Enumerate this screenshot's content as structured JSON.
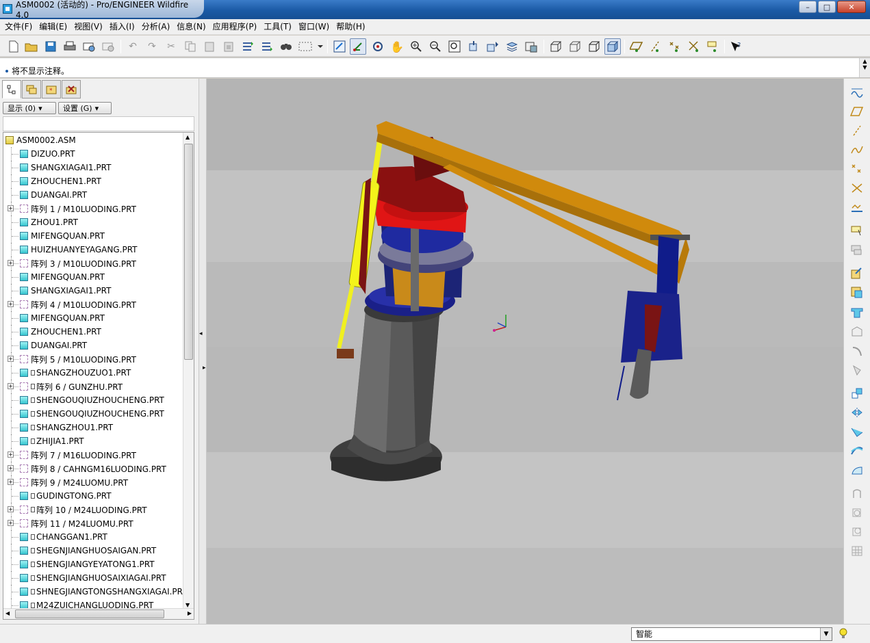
{
  "window": {
    "title": "ASM0002 (活动的) - Pro/ENGINEER Wildfire 4.0",
    "min_glyph": "–",
    "max_glyph": "□",
    "close_glyph": "✕"
  },
  "menu": [
    "文件(F)",
    "编辑(E)",
    "视图(V)",
    "插入(I)",
    "分析(A)",
    "信息(N)",
    "应用程序(P)",
    "工具(T)",
    "窗口(W)",
    "帮助(H)"
  ],
  "message": {
    "text": "将不显示注释。"
  },
  "model_tree": {
    "show_button": "显示 (0)",
    "settings_button": "设置 (G)",
    "items": [
      {
        "label": "ASM0002.ASM",
        "type": "asm",
        "level": 0,
        "expander": false
      },
      {
        "label": "DIZUO.PRT",
        "type": "prt",
        "level": 1,
        "expander": false
      },
      {
        "label": "SHANGXIAGAI1.PRT",
        "type": "prt",
        "level": 1,
        "expander": false
      },
      {
        "label": "ZHOUCHEN1.PRT",
        "type": "prt",
        "level": 1,
        "expander": false
      },
      {
        "label": "DUANGAI.PRT",
        "type": "prt",
        "level": 1,
        "expander": false
      },
      {
        "label": "阵列 1 / M10LUODING.PRT",
        "type": "pat",
        "level": 1,
        "expander": true
      },
      {
        "label": "ZHOU1.PRT",
        "type": "prt",
        "level": 1,
        "expander": false
      },
      {
        "label": "MIFENGQUAN.PRT",
        "type": "prt",
        "level": 1,
        "expander": false
      },
      {
        "label": "HUIZHUANYEYAGANG.PRT",
        "type": "prt",
        "level": 1,
        "expander": false
      },
      {
        "label": "阵列 3 / M10LUODING.PRT",
        "type": "pat",
        "level": 1,
        "expander": true
      },
      {
        "label": "MIFENGQUAN.PRT",
        "type": "prt",
        "level": 1,
        "expander": false
      },
      {
        "label": "SHANGXIAGAI1.PRT",
        "type": "prt",
        "level": 1,
        "expander": false
      },
      {
        "label": "阵列 4 / M10LUODING.PRT",
        "type": "pat",
        "level": 1,
        "expander": true
      },
      {
        "label": "MIFENGQUAN.PRT",
        "type": "prt",
        "level": 1,
        "expander": false
      },
      {
        "label": "ZHOUCHEN1.PRT",
        "type": "prt",
        "level": 1,
        "expander": false
      },
      {
        "label": "DUANGAI.PRT",
        "type": "prt",
        "level": 1,
        "expander": false
      },
      {
        "label": "阵列 5 / M10LUODING.PRT",
        "type": "pat",
        "level": 1,
        "expander": true
      },
      {
        "label": "SHANGZHOUZUO1.PRT",
        "type": "prt-small",
        "level": 1,
        "expander": false
      },
      {
        "label": "阵列 6 / GUNZHU.PRT",
        "type": "pat-small",
        "level": 1,
        "expander": true
      },
      {
        "label": "SHENGOUQIUZHOUCHENG.PRT",
        "type": "prt-small",
        "level": 1,
        "expander": false
      },
      {
        "label": "SHENGOUQIUZHOUCHENG.PRT",
        "type": "prt-small",
        "level": 1,
        "expander": false
      },
      {
        "label": "SHANGZHOU1.PRT",
        "type": "prt-small",
        "level": 1,
        "expander": false
      },
      {
        "label": "ZHIJIA1.PRT",
        "type": "prt-small",
        "level": 1,
        "expander": false
      },
      {
        "label": "阵列 7 / M16LUODING.PRT",
        "type": "pat",
        "level": 1,
        "expander": true
      },
      {
        "label": "阵列 8 / CAHNGM16LUODING.PRT",
        "type": "pat",
        "level": 1,
        "expander": true
      },
      {
        "label": "阵列 9 / M24LUOMU.PRT",
        "type": "pat",
        "level": 1,
        "expander": true
      },
      {
        "label": "GUDINGTONG.PRT",
        "type": "prt-small",
        "level": 1,
        "expander": false
      },
      {
        "label": "阵列 10 / M24LUODING.PRT",
        "type": "pat-small",
        "level": 1,
        "expander": true
      },
      {
        "label": "阵列 11 / M24LUOMU.PRT",
        "type": "pat",
        "level": 1,
        "expander": true
      },
      {
        "label": "CHANGGAN1.PRT",
        "type": "prt-small",
        "level": 1,
        "expander": false
      },
      {
        "label": "SHEGNJIANGHUOSAIGAN.PRT",
        "type": "prt-small",
        "level": 1,
        "expander": false
      },
      {
        "label": "SHENGJIANGYEYATONG1.PRT",
        "type": "prt-small",
        "level": 1,
        "expander": false
      },
      {
        "label": "SHENGJIANGHUOSAIXIAGAI.PRT",
        "type": "prt-small",
        "level": 1,
        "expander": false
      },
      {
        "label": "SHNEGJIANGTONGSHANGXIAGAI.PR",
        "type": "prt-small",
        "level": 1,
        "expander": false
      },
      {
        "label": "M24ZUICHANGLUODING.PRT",
        "type": "prt-small",
        "level": 1,
        "expander": false
      }
    ]
  },
  "status": {
    "filter_value": "智能"
  },
  "colors": {
    "graphics_bg": "#b9b9b9",
    "arm": "#d08a0c",
    "base": "#5b5b5b",
    "red_head": "#e01010",
    "dark_red": "#7a1414",
    "navy": "#101c8a",
    "cylinder": "#f4f41a"
  }
}
